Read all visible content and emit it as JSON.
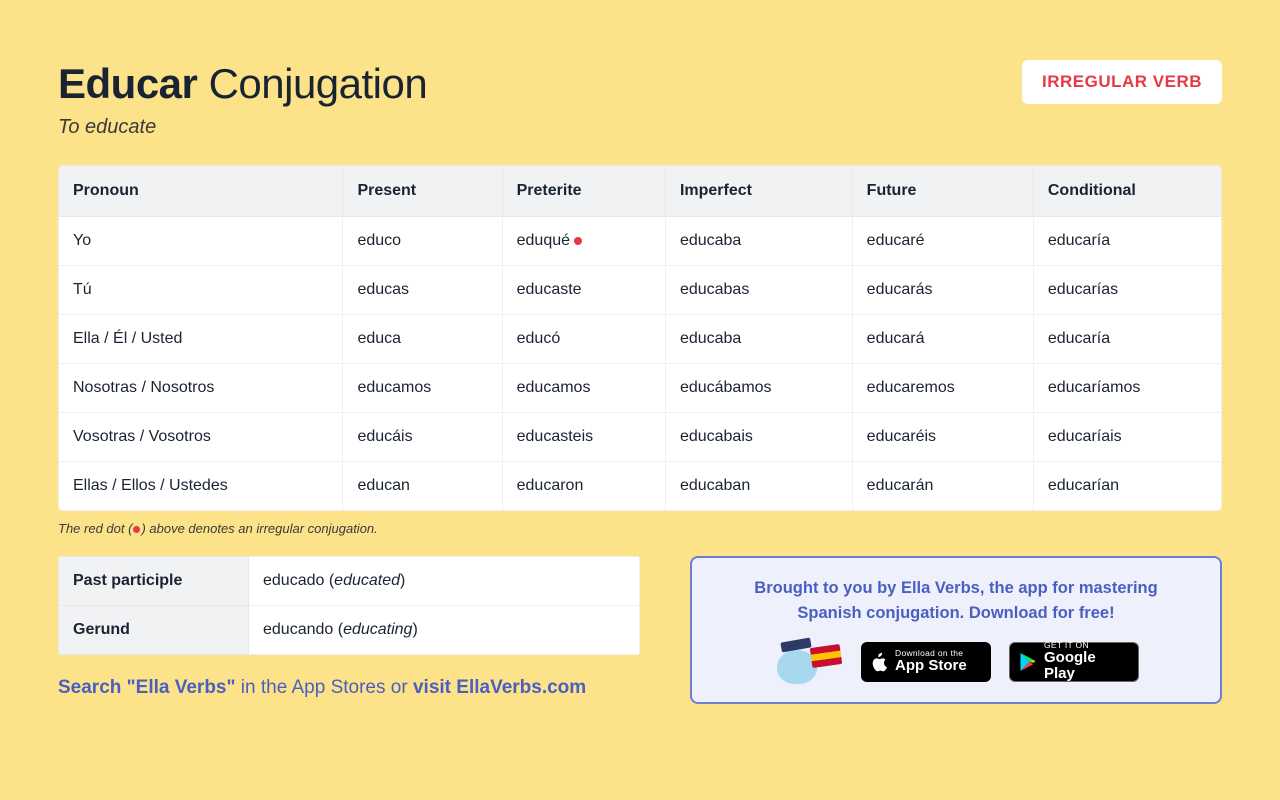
{
  "header": {
    "verb": "Educar",
    "title_suffix": "Conjugation",
    "translation": "To educate",
    "badge": "IRREGULAR VERB"
  },
  "table": {
    "headers": [
      "Pronoun",
      "Present",
      "Preterite",
      "Imperfect",
      "Future",
      "Conditional"
    ],
    "rows": [
      {
        "pronoun": "Yo",
        "cells": [
          "educo",
          "eduqué",
          "educaba",
          "educaré",
          "educaría"
        ],
        "irregular": [
          false,
          true,
          false,
          false,
          false
        ]
      },
      {
        "pronoun": "Tú",
        "cells": [
          "educas",
          "educaste",
          "educabas",
          "educarás",
          "educarías"
        ],
        "irregular": [
          false,
          false,
          false,
          false,
          false
        ]
      },
      {
        "pronoun": "Ella / Él / Usted",
        "cells": [
          "educa",
          "educó",
          "educaba",
          "educará",
          "educaría"
        ],
        "irregular": [
          false,
          false,
          false,
          false,
          false
        ]
      },
      {
        "pronoun": "Nosotras / Nosotros",
        "cells": [
          "educamos",
          "educamos",
          "educábamos",
          "educaremos",
          "educaríamos"
        ],
        "irregular": [
          false,
          false,
          false,
          false,
          false
        ]
      },
      {
        "pronoun": "Vosotras / Vosotros",
        "cells": [
          "educáis",
          "educasteis",
          "educabais",
          "educaréis",
          "educaríais"
        ],
        "irregular": [
          false,
          false,
          false,
          false,
          false
        ]
      },
      {
        "pronoun": "Ellas / Ellos / Ustedes",
        "cells": [
          "educan",
          "educaron",
          "educaban",
          "educarán",
          "educarían"
        ],
        "irregular": [
          false,
          false,
          false,
          false,
          false
        ]
      }
    ]
  },
  "legend": {
    "prefix": "The red dot (",
    "suffix": ") above denotes an irregular conjugation."
  },
  "forms": [
    {
      "label": "Past participle",
      "value": "educado",
      "translation": "educated"
    },
    {
      "label": "Gerund",
      "value": "educando",
      "translation": "educating"
    }
  ],
  "promo": {
    "line1": "Brought to you by Ella Verbs, the app for mastering",
    "line2": "Spanish conjugation. Download for free!",
    "appstore_small": "Download on the",
    "appstore_big": "App Store",
    "google_small": "GET IT ON",
    "google_big": "Google Play"
  },
  "search_line": {
    "part1": "Search \"Ella Verbs\"",
    "part2": " in the App Stores or ",
    "part3": "visit EllaVerbs.com"
  }
}
